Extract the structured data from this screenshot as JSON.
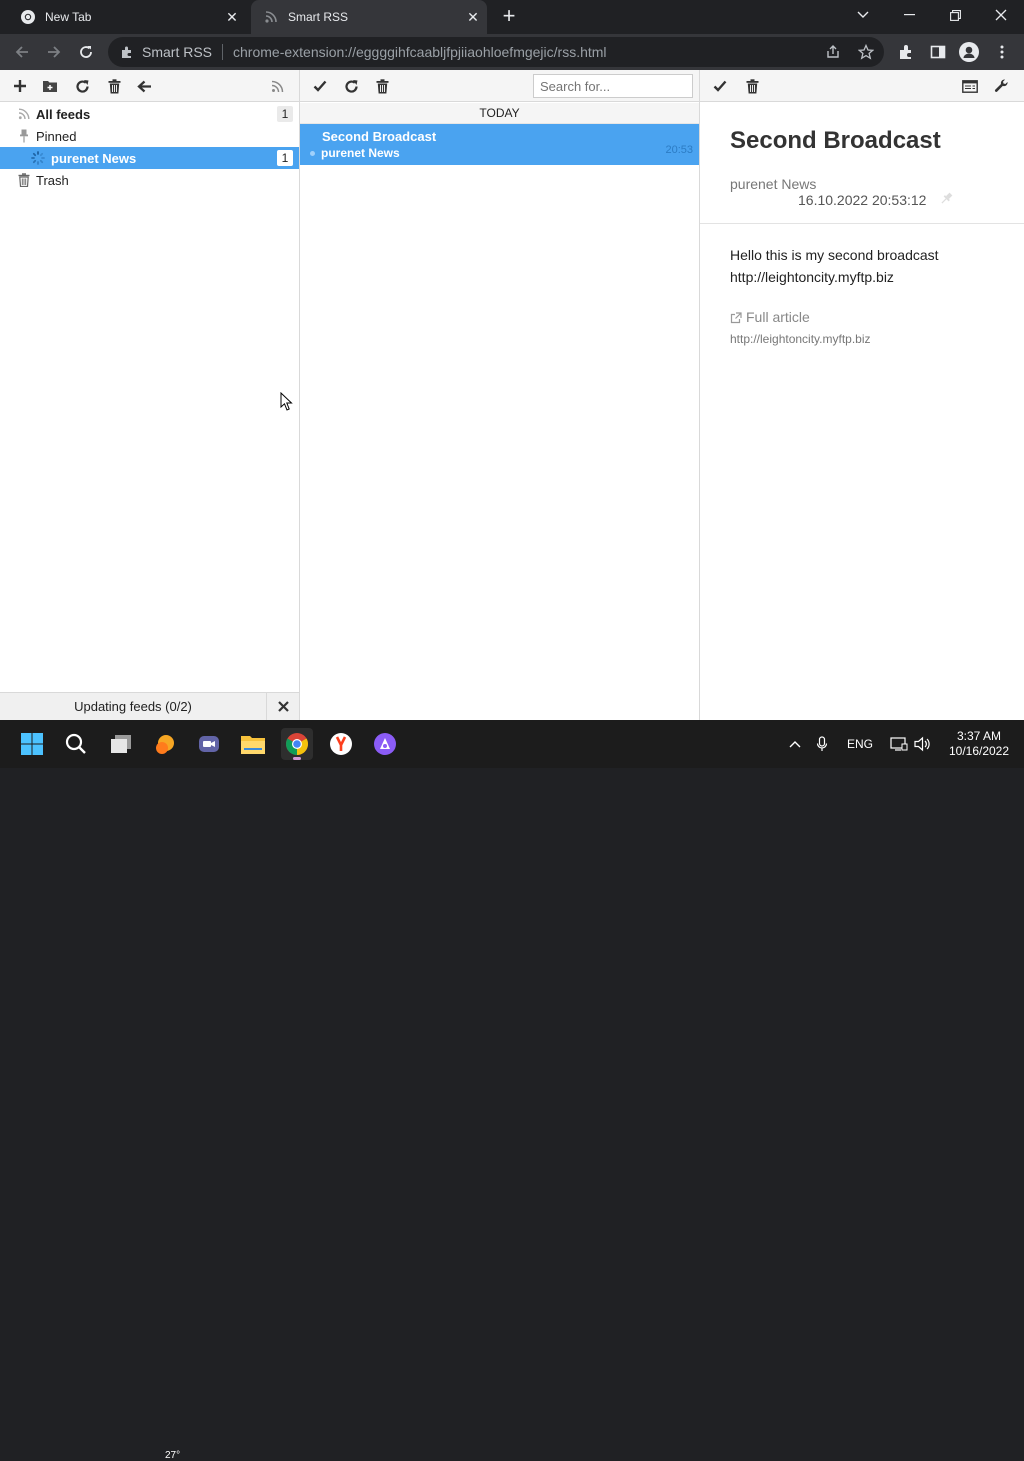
{
  "browser": {
    "tabs": [
      {
        "title": "New Tab",
        "icon": "chrome-icon"
      },
      {
        "title": "Smart RSS",
        "icon": "rss-icon"
      }
    ],
    "omnibox": {
      "site_name": "Smart RSS",
      "url": "chrome-extension://eggggihfcaabljfpjiiaohloefmgejic/rss.html"
    }
  },
  "feeds_pane": {
    "items": [
      {
        "label": "All feeds",
        "count": "1",
        "icon": "rss-icon"
      },
      {
        "label": "Pinned",
        "icon": "pin-icon"
      },
      {
        "label": "purenet News",
        "count": "1",
        "icon": "loading-spinner-icon",
        "selected": true
      },
      {
        "label": "Trash",
        "icon": "trash-icon"
      }
    ],
    "status": "Updating feeds (0/2)"
  },
  "articles_pane": {
    "search_placeholder": "Search for...",
    "group_header": "TODAY",
    "articles": [
      {
        "title": "Second Broadcast",
        "feed": "purenet News",
        "time": "20:53",
        "selected": true
      }
    ]
  },
  "content_pane": {
    "title": "Second Broadcast",
    "feed": "purenet News",
    "date": "16.10.2022 20:53:12",
    "body_line1": "Hello this is my second broadcast",
    "body_line2": "http://leightoncity.myftp.biz",
    "full_article_label": "Full article",
    "full_article_url": "http://leightoncity.myftp.biz"
  },
  "taskbar": {
    "weather_temp": "27°",
    "language": "ENG",
    "time": "3:37 AM",
    "date": "10/16/2022"
  },
  "colors": {
    "selection_blue": "#4aa3f0",
    "chrome_dark": "#202124",
    "chrome_toolbar": "#35363a"
  }
}
